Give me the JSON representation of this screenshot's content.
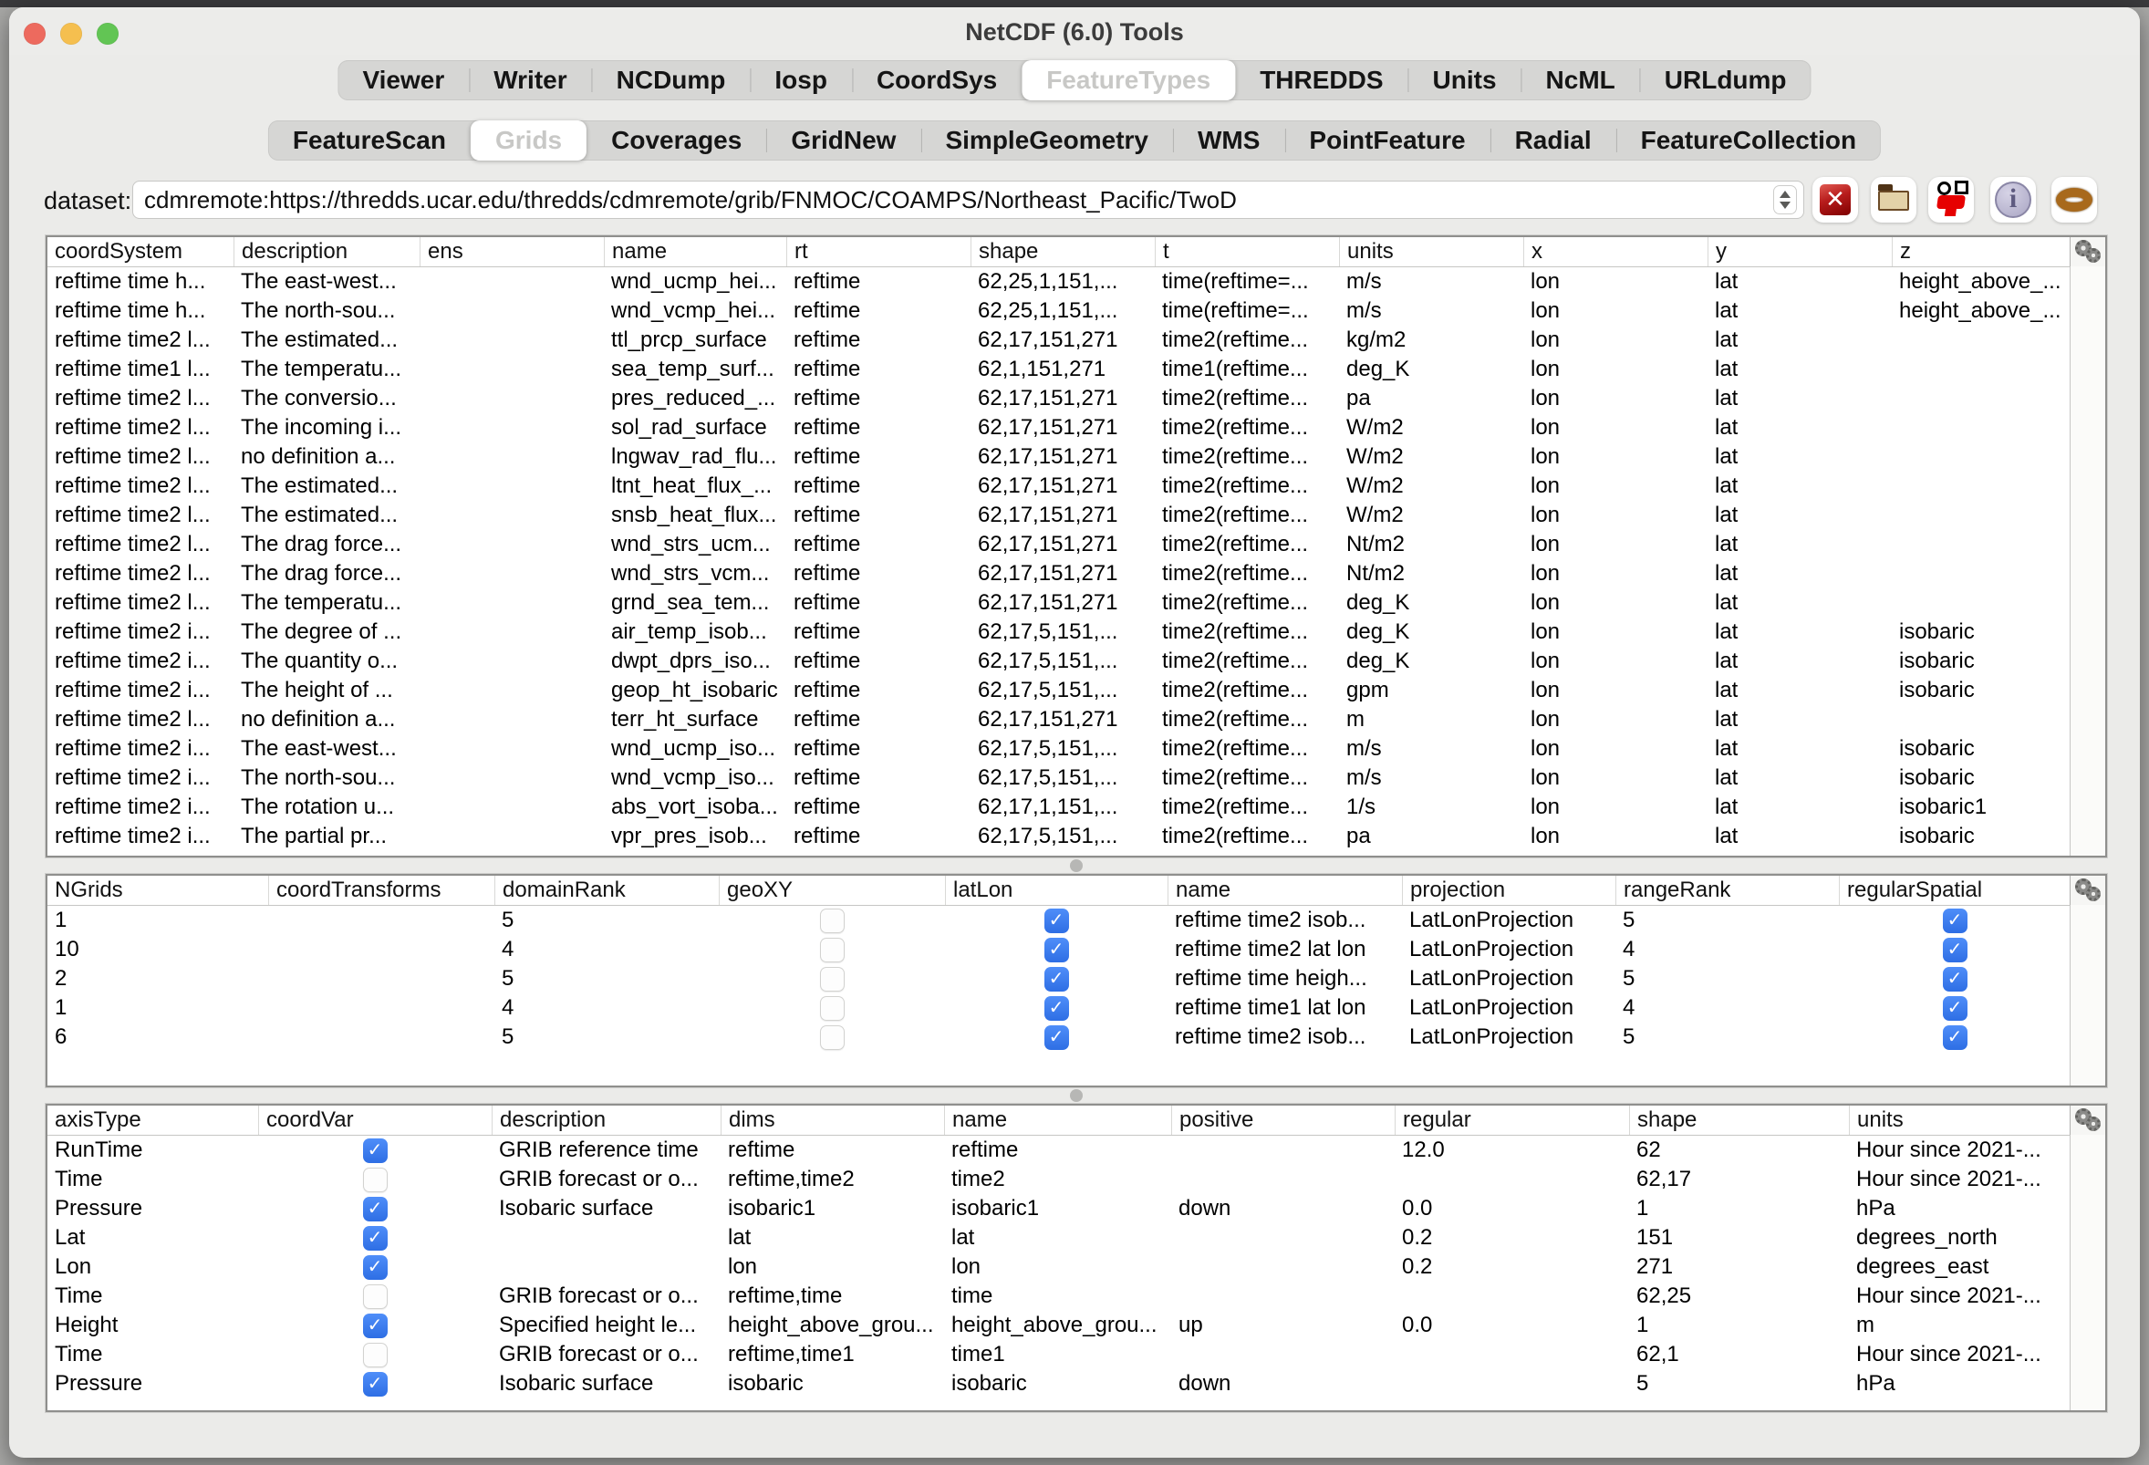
{
  "window": {
    "title": "NetCDF (6.0) Tools"
  },
  "traffic_lights": [
    "close",
    "minimize",
    "zoom"
  ],
  "tabs_primary": {
    "selected": "FeatureTypes",
    "items": [
      "Viewer",
      "Writer",
      "NCDump",
      "Iosp",
      "CoordSys",
      "FeatureTypes",
      "THREDDS",
      "Units",
      "NcML",
      "URLdump"
    ]
  },
  "tabs_secondary": {
    "selected": "Grids",
    "items": [
      "FeatureScan",
      "Grids",
      "Coverages",
      "GridNew",
      "SimpleGeometry",
      "WMS",
      "PointFeature",
      "Radial",
      "FeatureCollection"
    ]
  },
  "toolbar": {
    "dataset_label": "dataset:",
    "dataset_value": "cdmremote:https://thredds.ucar.edu/thredds/cdmremote/grib/FNMOC/COAMPS/Northeast_Pacific/TwoD",
    "icons": [
      "clear-icon",
      "open-folder-icon",
      "bug-icon",
      "info-icon",
      "ring-icon"
    ]
  },
  "colors": {
    "checkbox_checked": "#2f6fe4",
    "selected_tab_bg": "#ffffff",
    "clear_button_red": "#b71c1c"
  },
  "grid_table": {
    "columns": [
      "coordSystem",
      "description",
      "ens",
      "name",
      "rt",
      "shape",
      "t",
      "units",
      "x",
      "y",
      "z"
    ],
    "rows": [
      [
        "reftime time h...",
        "The east-west...",
        "",
        "wnd_ucmp_hei...",
        "reftime",
        "62,25,1,151,...",
        "time(reftime=...",
        "m/s",
        "lon",
        "lat",
        "height_above_..."
      ],
      [
        "reftime time h...",
        "The north-sou...",
        "",
        "wnd_vcmp_hei...",
        "reftime",
        "62,25,1,151,...",
        "time(reftime=...",
        "m/s",
        "lon",
        "lat",
        "height_above_..."
      ],
      [
        "reftime time2 l...",
        "The estimated...",
        "",
        "ttl_prcp_surface",
        "reftime",
        "62,17,151,271",
        "time2(reftime...",
        "kg/m2",
        "lon",
        "lat",
        ""
      ],
      [
        "reftime time1 l...",
        "The temperatu...",
        "",
        "sea_temp_surf...",
        "reftime",
        "62,1,151,271",
        "time1(reftime...",
        "deg_K",
        "lon",
        "lat",
        ""
      ],
      [
        "reftime time2 l...",
        "The conversio...",
        "",
        "pres_reduced_...",
        "reftime",
        "62,17,151,271",
        "time2(reftime...",
        "pa",
        "lon",
        "lat",
        ""
      ],
      [
        "reftime time2 l...",
        "The incoming i...",
        "",
        "sol_rad_surface",
        "reftime",
        "62,17,151,271",
        "time2(reftime...",
        "W/m2",
        "lon",
        "lat",
        ""
      ],
      [
        "reftime time2 l...",
        "no definition a...",
        "",
        "lngwav_rad_flu...",
        "reftime",
        "62,17,151,271",
        "time2(reftime...",
        "W/m2",
        "lon",
        "lat",
        ""
      ],
      [
        "reftime time2 l...",
        "The estimated...",
        "",
        "ltnt_heat_flux_...",
        "reftime",
        "62,17,151,271",
        "time2(reftime...",
        "W/m2",
        "lon",
        "lat",
        ""
      ],
      [
        "reftime time2 l...",
        "The estimated...",
        "",
        "snsb_heat_flux...",
        "reftime",
        "62,17,151,271",
        "time2(reftime...",
        "W/m2",
        "lon",
        "lat",
        ""
      ],
      [
        "reftime time2 l...",
        "The drag force...",
        "",
        "wnd_strs_ucm...",
        "reftime",
        "62,17,151,271",
        "time2(reftime...",
        "Nt/m2",
        "lon",
        "lat",
        ""
      ],
      [
        "reftime time2 l...",
        "The drag force...",
        "",
        "wnd_strs_vcm...",
        "reftime",
        "62,17,151,271",
        "time2(reftime...",
        "Nt/m2",
        "lon",
        "lat",
        ""
      ],
      [
        "reftime time2 l...",
        "The temperatu...",
        "",
        "grnd_sea_tem...",
        "reftime",
        "62,17,151,271",
        "time2(reftime...",
        "deg_K",
        "lon",
        "lat",
        ""
      ],
      [
        "reftime time2 i...",
        "The degree of ...",
        "",
        "air_temp_isob...",
        "reftime",
        "62,17,5,151,...",
        "time2(reftime...",
        "deg_K",
        "lon",
        "lat",
        "isobaric"
      ],
      [
        "reftime time2 i...",
        "The quantity o...",
        "",
        "dwpt_dprs_iso...",
        "reftime",
        "62,17,5,151,...",
        "time2(reftime...",
        "deg_K",
        "lon",
        "lat",
        "isobaric"
      ],
      [
        "reftime time2 i...",
        "The height of ...",
        "",
        "geop_ht_isobaric",
        "reftime",
        "62,17,5,151,...",
        "time2(reftime...",
        "gpm",
        "lon",
        "lat",
        "isobaric"
      ],
      [
        "reftime time2 l...",
        "no definition a...",
        "",
        "terr_ht_surface",
        "reftime",
        "62,17,151,271",
        "time2(reftime...",
        "m",
        "lon",
        "lat",
        ""
      ],
      [
        "reftime time2 i...",
        "The east-west...",
        "",
        "wnd_ucmp_iso...",
        "reftime",
        "62,17,5,151,...",
        "time2(reftime...",
        "m/s",
        "lon",
        "lat",
        "isobaric"
      ],
      [
        "reftime time2 i...",
        "The north-sou...",
        "",
        "wnd_vcmp_iso...",
        "reftime",
        "62,17,5,151,...",
        "time2(reftime...",
        "m/s",
        "lon",
        "lat",
        "isobaric"
      ],
      [
        "reftime time2 i...",
        "The rotation u...",
        "",
        "abs_vort_isoba...",
        "reftime",
        "62,17,1,151,...",
        "time2(reftime...",
        "1/s",
        "lon",
        "lat",
        "isobaric1"
      ],
      [
        "reftime time2 i...",
        "The partial pr...",
        "",
        "vpr_pres_isob...",
        "reftime",
        "62,17,5,151,...",
        "time2(reftime...",
        "pa",
        "lon",
        "lat",
        "isobaric"
      ]
    ]
  },
  "coordsys_table": {
    "columns": [
      "NGrids",
      "coordTransforms",
      "domainRank",
      "geoXY",
      "latLon",
      "name",
      "projection",
      "rangeRank",
      "regularSpatial"
    ],
    "rows": [
      [
        "1",
        "",
        "5",
        false,
        true,
        "reftime time2 isob...",
        "LatLonProjection",
        "5",
        true
      ],
      [
        "10",
        "",
        "4",
        false,
        true,
        "reftime time2 lat lon",
        "LatLonProjection",
        "4",
        true
      ],
      [
        "2",
        "",
        "5",
        false,
        true,
        "reftime time heigh...",
        "LatLonProjection",
        "5",
        true
      ],
      [
        "1",
        "",
        "4",
        false,
        true,
        "reftime time1 lat lon",
        "LatLonProjection",
        "4",
        true
      ],
      [
        "6",
        "",
        "5",
        false,
        true,
        "reftime time2 isob...",
        "LatLonProjection",
        "5",
        true
      ]
    ]
  },
  "axis_table": {
    "columns": [
      "axisType",
      "coordVar",
      "description",
      "dims",
      "name",
      "positive",
      "regular",
      "shape",
      "units"
    ],
    "rows": [
      [
        "RunTime",
        true,
        "GRIB reference time",
        "reftime",
        "reftime",
        "",
        "12.0",
        "62",
        "Hour since 2021-..."
      ],
      [
        "Time",
        false,
        "GRIB forecast or o...",
        "reftime,time2",
        "time2",
        "",
        "",
        "62,17",
        "Hour since 2021-..."
      ],
      [
        "Pressure",
        true,
        "Isobaric surface",
        "isobaric1",
        "isobaric1",
        "down",
        "0.0",
        "1",
        "hPa"
      ],
      [
        "Lat",
        true,
        "",
        "lat",
        "lat",
        "",
        "0.2",
        "151",
        "degrees_north"
      ],
      [
        "Lon",
        true,
        "",
        "lon",
        "lon",
        "",
        "0.2",
        "271",
        "degrees_east"
      ],
      [
        "Time",
        false,
        "GRIB forecast or o...",
        "reftime,time",
        "time",
        "",
        "",
        "62,25",
        "Hour since 2021-..."
      ],
      [
        "Height",
        true,
        "Specified height le...",
        "height_above_grou...",
        "height_above_grou...",
        "up",
        "0.0",
        "1",
        "m"
      ],
      [
        "Time",
        false,
        "GRIB forecast or o...",
        "reftime,time1",
        "time1",
        "",
        "",
        "62,1",
        "Hour since 2021-..."
      ],
      [
        "Pressure",
        true,
        "Isobaric surface",
        "isobaric",
        "isobaric",
        "down",
        "",
        "5",
        "hPa"
      ]
    ]
  }
}
